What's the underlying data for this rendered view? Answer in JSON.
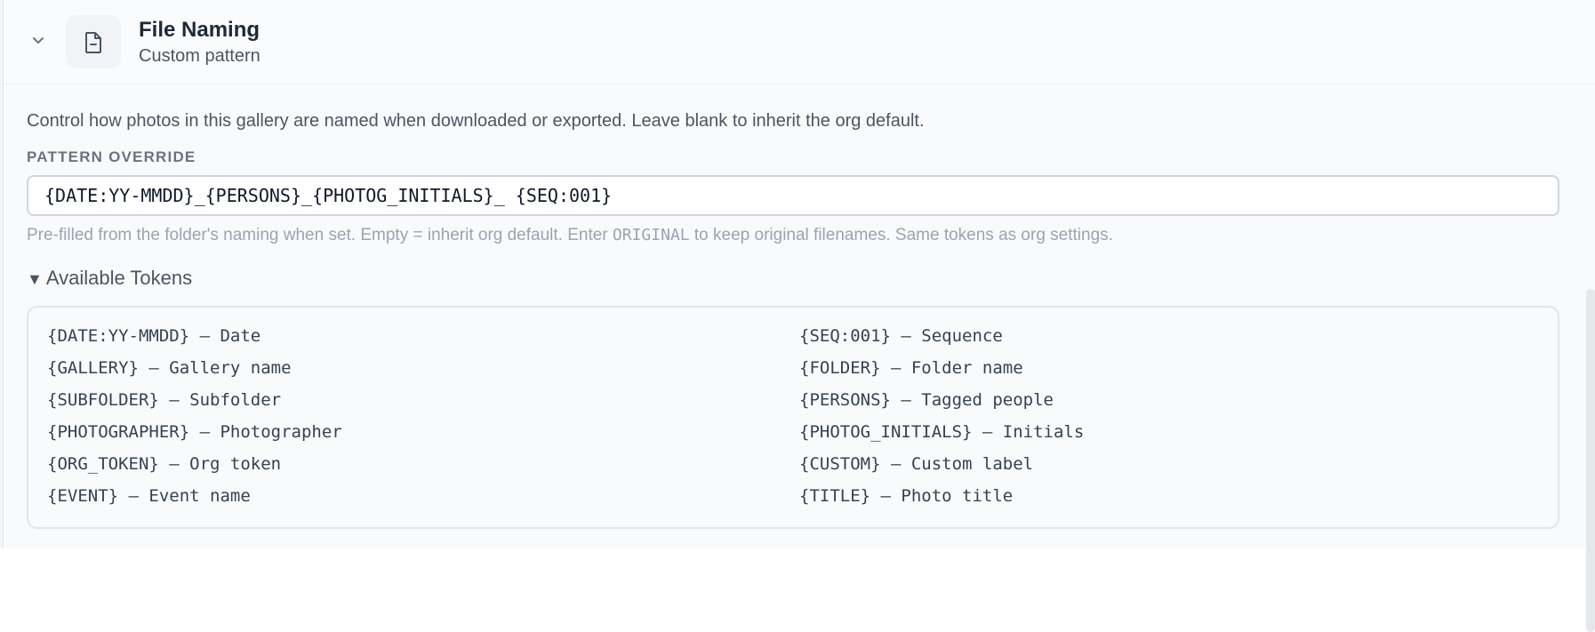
{
  "header": {
    "title": "File Naming",
    "subtitle": "Custom pattern",
    "chevron_icon": "chevron-down-icon",
    "file_icon": "file-icon"
  },
  "main": {
    "description": "Control how photos in this gallery are named when downloaded or exported. Leave blank to inherit the org default.",
    "field_label": "PATTERN OVERRIDE",
    "pattern_value": "{DATE:YY-MMDD}_{PERSONS}_{PHOTOG_INITIALS}_ {SEQ:001}",
    "hint_before": "Pre-filled from the folder's naming when set. Empty = inherit org default. Enter ",
    "hint_code": "ORIGINAL",
    "hint_after": " to keep original filenames. Same tokens as org settings.",
    "tokens_toggle_label": "Available Tokens",
    "tokens_left": [
      "{DATE:YY-MMDD} — Date",
      "{GALLERY} — Gallery name",
      "{SUBFOLDER} — Subfolder",
      "{PHOTOGRAPHER} — Photographer",
      "{ORG_TOKEN} — Org token",
      "{EVENT} — Event name"
    ],
    "tokens_right": [
      "{SEQ:001} — Sequence",
      "{FOLDER} — Folder name",
      "{PERSONS} — Tagged people",
      "{PHOTOG_INITIALS} — Initials",
      "{CUSTOM} — Custom label",
      "{TITLE} — Photo title"
    ]
  },
  "colors": {
    "title_text": "#1f2937",
    "muted_text": "#4b5563",
    "hint_text": "#9ca3af",
    "border": "#d1d5db",
    "panel_bg": "#f9fafb"
  }
}
